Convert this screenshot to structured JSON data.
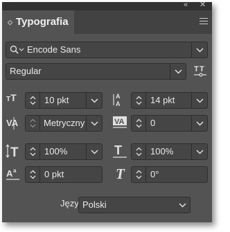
{
  "window": {
    "collapse_label": "«",
    "close_label": "✕"
  },
  "panel": {
    "tab_title": "Typografia"
  },
  "font_family": {
    "value": "Encode Sans"
  },
  "font_style": {
    "value": "Regular"
  },
  "font_size": {
    "value": "10 pkt"
  },
  "leading": {
    "value": "14 pkt"
  },
  "kerning": {
    "value": "Metryczny"
  },
  "tracking": {
    "value": "0"
  },
  "vertical_scale": {
    "value": "100%"
  },
  "horizontal_scale": {
    "value": "100%"
  },
  "baseline_shift": {
    "value": "0 pkt"
  },
  "skew": {
    "value": "0°"
  },
  "language": {
    "label": "Język:",
    "value": "Polski"
  },
  "icons": {
    "search": "search-icon",
    "style_options": "font-style-options-icon",
    "size": "font-size-icon",
    "leading": "leading-icon",
    "kerning": "kerning-icon",
    "tracking": "tracking-icon",
    "vscale": "vertical-scale-icon",
    "hscale": "horizontal-scale-icon",
    "baseline": "baseline-shift-icon",
    "skew": "skew-icon",
    "panel_menu": "panel-menu-icon"
  }
}
